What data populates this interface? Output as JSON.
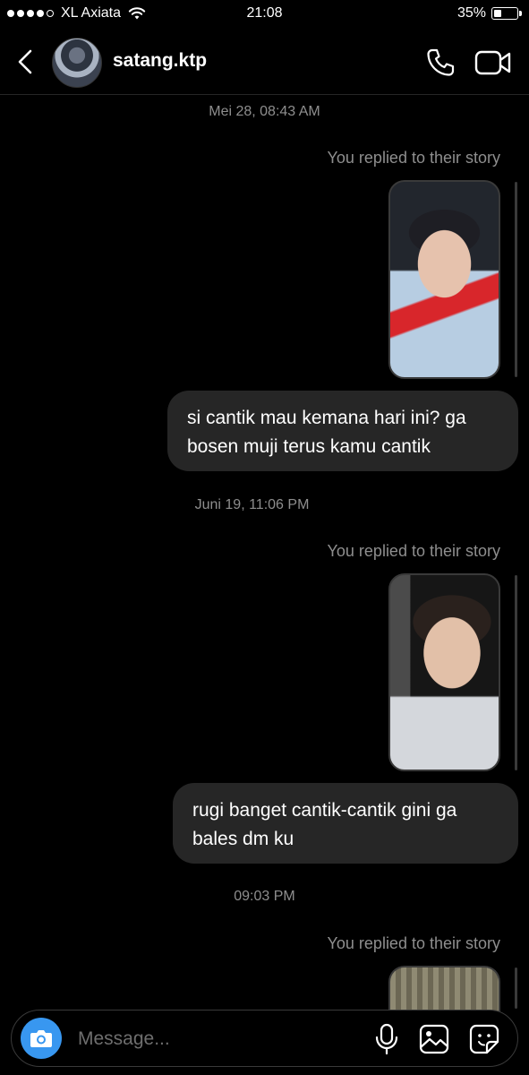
{
  "status_bar": {
    "carrier": "XL Axiata",
    "time": "21:08",
    "battery_percent": "35%",
    "battery_level": 0.35,
    "signal_bars": 4,
    "signal_total": 5
  },
  "header": {
    "username": "satang.ktp",
    "icons": [
      "back-chevron-icon",
      "avatar",
      "phone-icon",
      "video-camera-icon"
    ]
  },
  "conversation": {
    "groups": [
      {
        "timestamp": "Mei 28, 08:43 AM",
        "reply_note": "You replied to their story",
        "message": "si cantik mau kemana hari ini? ga bosen muji terus kamu cantik"
      },
      {
        "timestamp": "Juni 19, 11:06 PM",
        "reply_note": "You replied to their story",
        "message": "rugi banget cantik-cantik gini ga bales dm ku"
      },
      {
        "timestamp": "09:03 PM",
        "reply_note": "You replied to their story"
      }
    ]
  },
  "composer": {
    "placeholder": "Message...",
    "icons": [
      "camera-icon",
      "microphone-icon",
      "gallery-icon",
      "sticker-icon"
    ],
    "accent_color": "#3897f0"
  },
  "colors": {
    "background": "#000000",
    "bubble": "#262626",
    "muted_text": "#8e8e8e"
  }
}
